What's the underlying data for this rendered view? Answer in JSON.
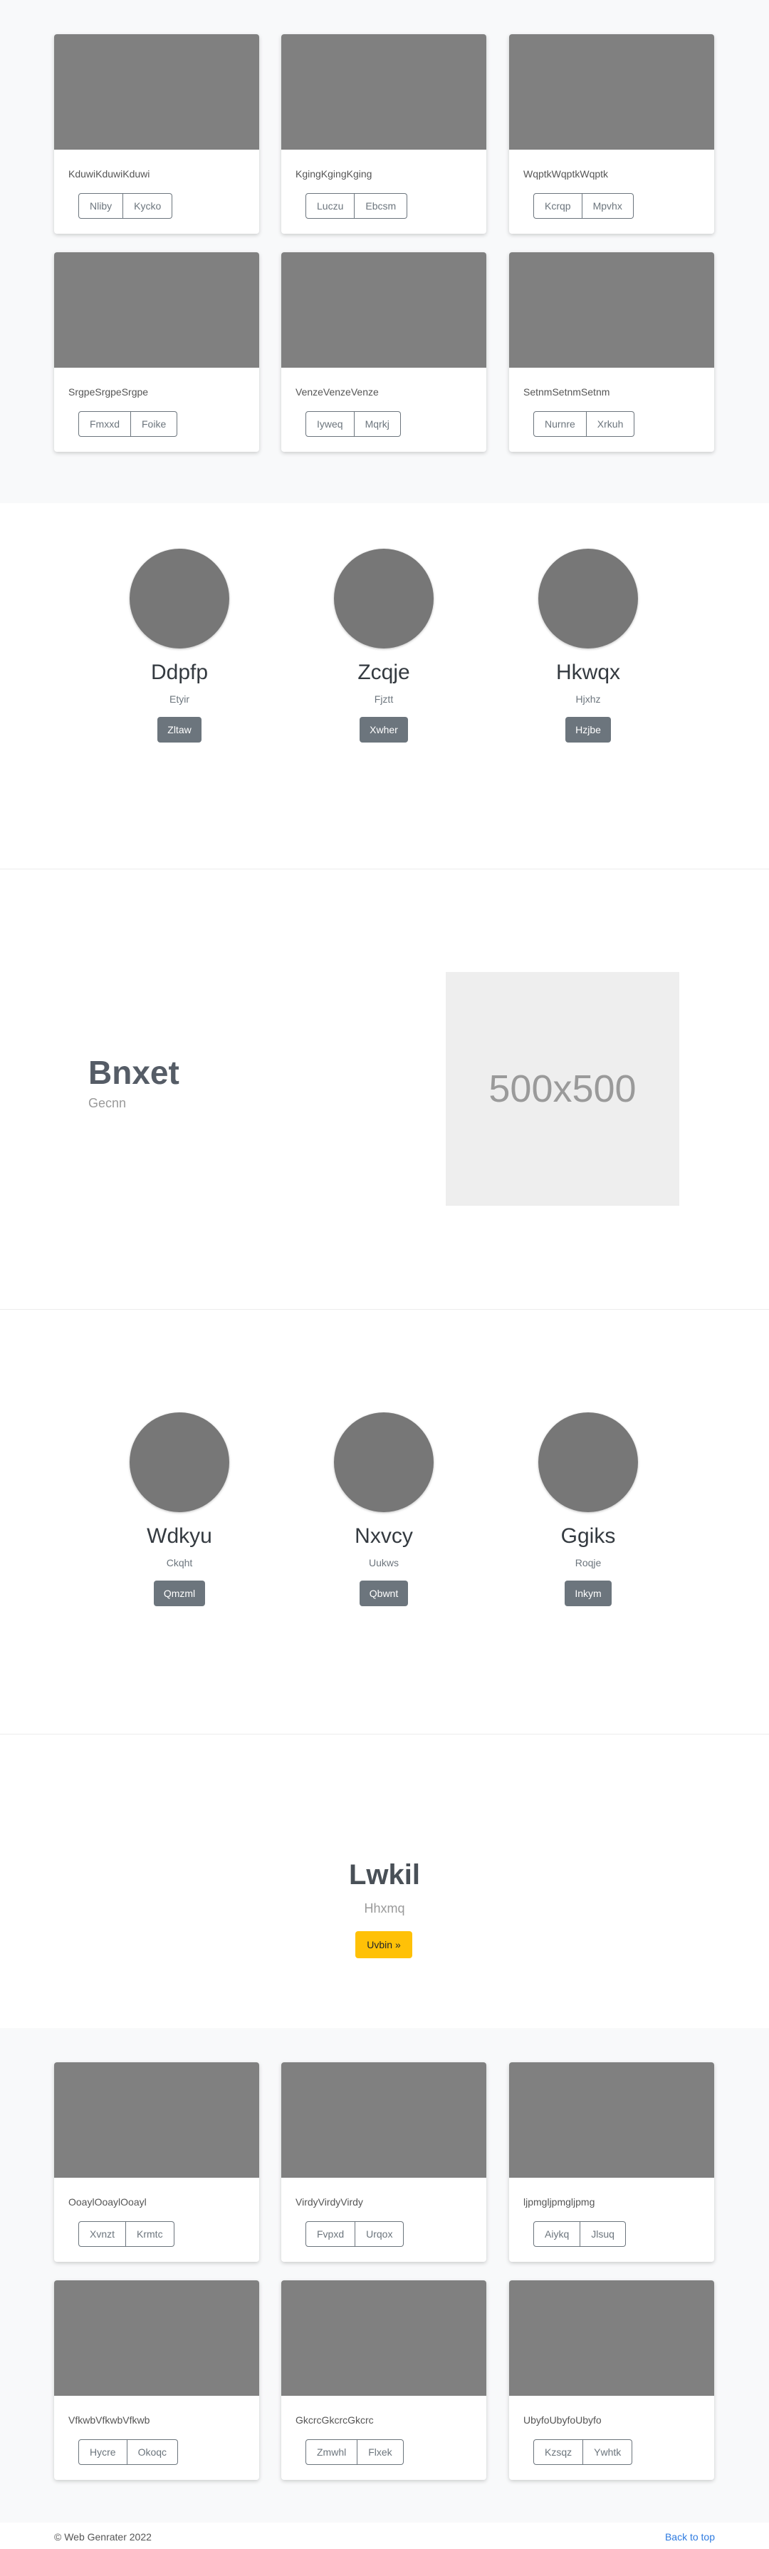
{
  "cards_top": [
    {
      "text": "KduwiKduwiKduwi",
      "buttons": [
        "Nliby",
        "Kycko"
      ]
    },
    {
      "text": "KgingKgingKging",
      "buttons": [
        "Luczu",
        "Ebcsm"
      ]
    },
    {
      "text": "WqptkWqptkWqptk",
      "buttons": [
        "Kcrqp",
        "Mpvhx"
      ]
    },
    {
      "text": "SrgpeSrgpeSrgpe",
      "buttons": [
        "Fmxxd",
        "Foike"
      ]
    },
    {
      "text": "VenzeVenzeVenze",
      "buttons": [
        "Iyweq",
        "Mqrkj"
      ]
    },
    {
      "text": "SetnmSetnmSetnm",
      "buttons": [
        "Nurnre",
        "Xrkuh"
      ]
    }
  ],
  "team_one": [
    {
      "name": "Ddpfp",
      "role": "Etyir",
      "button": "Zltaw"
    },
    {
      "name": "Zcqje",
      "role": "Fjztt",
      "button": "Xwher"
    },
    {
      "name": "Hkwqx",
      "role": "Hjxhz",
      "button": "Hzjbe"
    }
  ],
  "feature": {
    "title": "Bnxet",
    "subtitle": "Gecnn",
    "image_label": "500x500"
  },
  "team_two": [
    {
      "name": "Wdkyu",
      "role": "Ckqht",
      "button": "Qmzml"
    },
    {
      "name": "Nxvcy",
      "role": "Uukws",
      "button": "Qbwnt"
    },
    {
      "name": "Ggiks",
      "role": "Roqje",
      "button": "Inkym"
    }
  ],
  "cta": {
    "title": "Lwkil",
    "subtitle": "Hhxmq",
    "button": "Uvbin »"
  },
  "cards_bottom": [
    {
      "text": "OoaylOoaylOoayl",
      "buttons": [
        "Xvnzt",
        "Krmtc"
      ]
    },
    {
      "text": "VirdyVirdyVirdy",
      "buttons": [
        "Fvpxd",
        "Urqox"
      ]
    },
    {
      "text": "ljpmgljpmgljpmg",
      "buttons": [
        "Aiykq",
        "Jlsuq"
      ]
    },
    {
      "text": "VfkwbVfkwbVfkwb",
      "buttons": [
        "Hycre",
        "Okoqc"
      ]
    },
    {
      "text": "GkcrcGkcrcGkcrc",
      "buttons": [
        "Zmwhl",
        "Flxek"
      ]
    },
    {
      "text": "UbyfoUbyfoUbyfo",
      "buttons": [
        "Kzsqz",
        "Ywhtk"
      ]
    }
  ],
  "footer": {
    "copyright": "© Web Genrater 2022",
    "back_to_top": "Back to top"
  },
  "colors": {
    "thumb": "#808080",
    "avatar": "#777777",
    "secondary_button": "#6c757d",
    "cta_button": "#ffc107",
    "link": "#2f7be0"
  }
}
